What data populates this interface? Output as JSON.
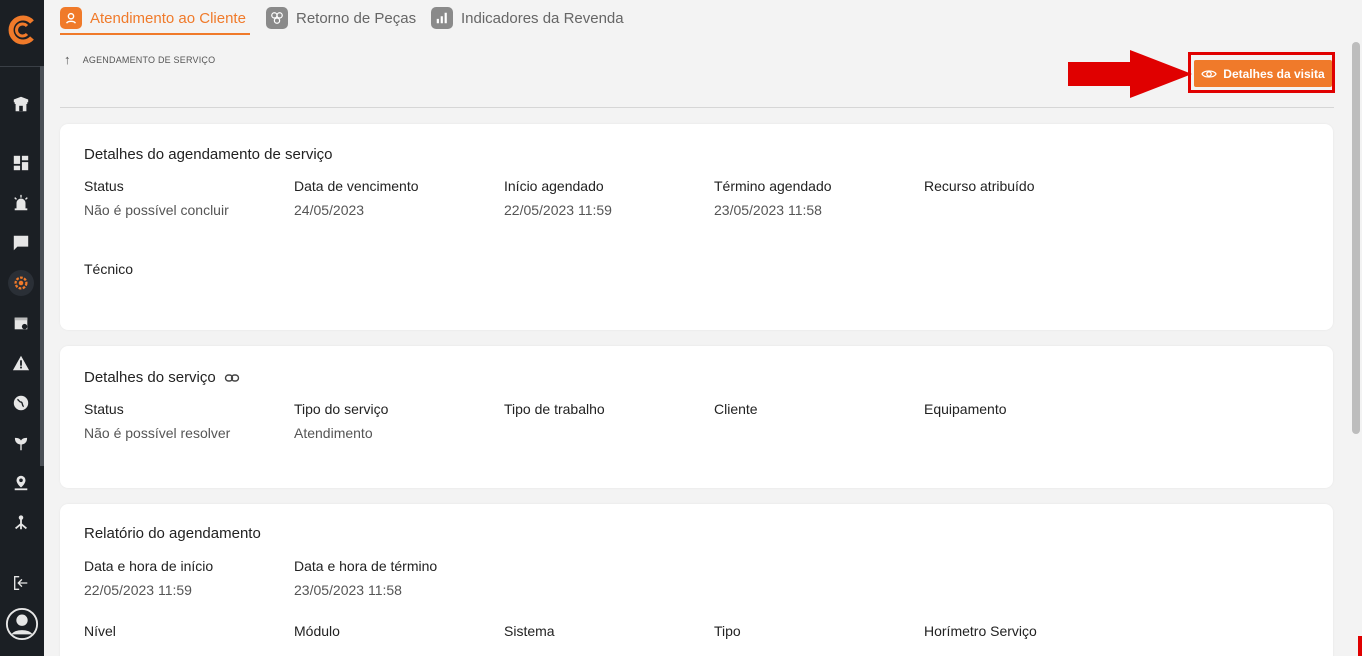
{
  "tabs": [
    {
      "label": "Atendimento ao Cliente",
      "active": true
    },
    {
      "label": "Retorno de Peças",
      "active": false
    },
    {
      "label": "Indicadores da Revenda",
      "active": false
    }
  ],
  "breadcrumb": "AGENDAMENTO DE SERVIÇO",
  "visit_button": "Detalhes da visita",
  "colors": {
    "accent": "#f07a2a",
    "sidebar": "#1b1f24",
    "highlight": "#e00000"
  },
  "card1": {
    "title": "Detalhes do agendamento de serviço",
    "fields": [
      {
        "label": "Status",
        "value": "Não é possível concluir"
      },
      {
        "label": "Data de vencimento",
        "value": "24/05/2023"
      },
      {
        "label": "Início agendado",
        "value": "22/05/2023 11:59"
      },
      {
        "label": "Término agendado",
        "value": "23/05/2023 11:58"
      },
      {
        "label": "Recurso atribuído",
        "value": ""
      },
      {
        "label": "Técnico",
        "value": ""
      }
    ]
  },
  "card2": {
    "title": "Detalhes do serviço",
    "fields": [
      {
        "label": "Status",
        "value": "Não é possível resolver"
      },
      {
        "label": "Tipo do serviço",
        "value": "Atendimento"
      },
      {
        "label": "Tipo de trabalho",
        "value": ""
      },
      {
        "label": "Cliente",
        "value": ""
      },
      {
        "label": "Equipamento",
        "value": ""
      }
    ]
  },
  "card3": {
    "title": "Relatório do agendamento",
    "fields": [
      {
        "label": "Data e hora de início",
        "value": "22/05/2023 11:59"
      },
      {
        "label": "Data e hora de término",
        "value": "23/05/2023 11:58"
      },
      {
        "label": "Nível",
        "value": ""
      },
      {
        "label": "Módulo",
        "value": ""
      },
      {
        "label": "Sistema",
        "value": ""
      },
      {
        "label": "Tipo",
        "value": ""
      },
      {
        "label": "Horímetro Serviço",
        "value": ""
      }
    ]
  }
}
